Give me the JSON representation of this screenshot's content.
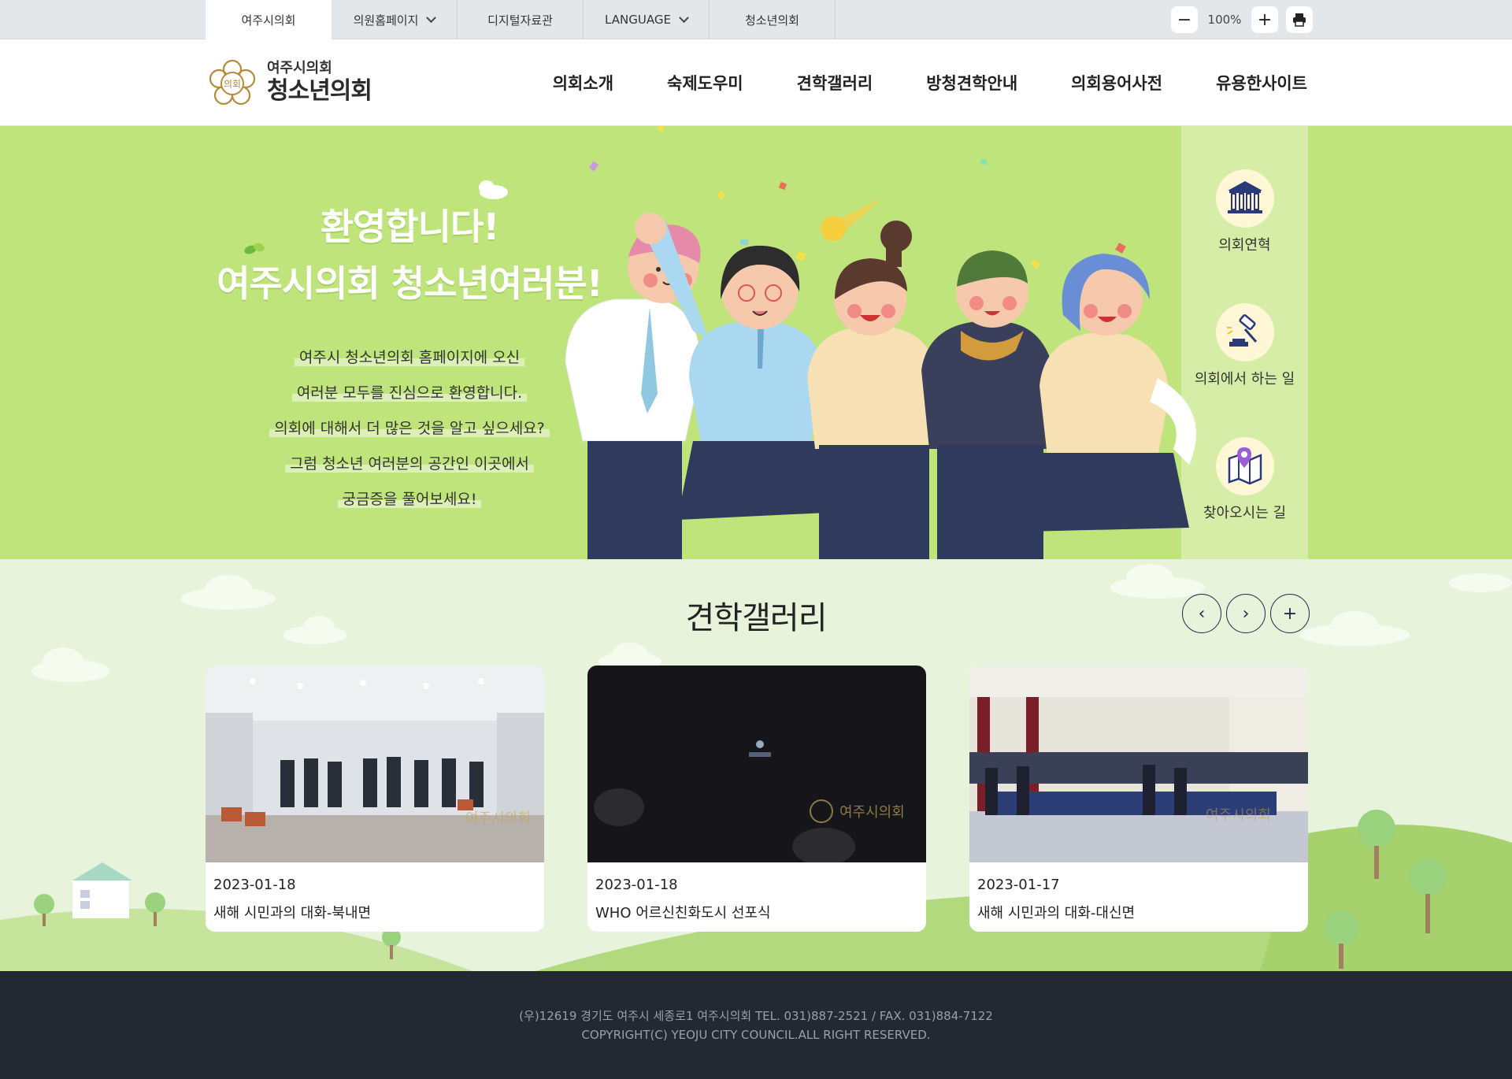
{
  "util": {
    "tabs": [
      {
        "label": "여주시의회"
      },
      {
        "label": "의원홈페이지"
      },
      {
        "label": "디지털자료관"
      },
      {
        "label": "LANGUAGE"
      },
      {
        "label": "청소년의회"
      }
    ],
    "zoom": {
      "minus": "−",
      "value": "100%",
      "plus": "+"
    }
  },
  "logo": {
    "small": "여주시의회",
    "big": "청소년의회",
    "emblem_text": "의회"
  },
  "gnb": [
    {
      "label": "의회소개"
    },
    {
      "label": "숙제도우미"
    },
    {
      "label": "견학갤러리"
    },
    {
      "label": "방청견학안내"
    },
    {
      "label": "의회용어사전"
    },
    {
      "label": "유용한사이트"
    }
  ],
  "hero": {
    "title_line1": "환영합니다!",
    "title_line2": "여주시의회 청소년여러분!",
    "desc": [
      "여주시 청소년의회 홈페이지에 오신",
      "여러분 모두를 진심으로 환영합니다.",
      "의회에 대해서 더 많은 것을 알고 싶으세요?",
      "그럼 청소년 여러분의 공간인 이곳에서",
      "궁금증을 풀어보세요!"
    ]
  },
  "side": [
    {
      "label": "의회연혁",
      "icon": "building-icon"
    },
    {
      "label": "의회에서 하는 일",
      "icon": "gavel-icon"
    },
    {
      "label": "찾아오시는 길",
      "icon": "map-pin-icon"
    }
  ],
  "gallery": {
    "title": "견학갤러리",
    "prev": "‹",
    "next": "›",
    "more": "+",
    "items": [
      {
        "date": "2023-01-18",
        "caption": "새해 시민과의 대화-북내면",
        "watermark": "여주시의회"
      },
      {
        "date": "2023-01-18",
        "caption": "WHO 어르신친화도시 선포식",
        "watermark": "여주시의회"
      },
      {
        "date": "2023-01-17",
        "caption": "새해 시민과의 대화-대신면",
        "watermark": "여주시의회"
      }
    ]
  },
  "footer": {
    "address": "(우)12619 경기도 여주시 세종로1 여주시의회 TEL. 031)887-2521 / FAX. 031)884-7122",
    "copyright": "COPYRIGHT(C) YEOJU CITY COUNCIL.ALL RIGHT RESERVED."
  },
  "colors": {
    "hero_bg": "#c0e47c",
    "side_bg": "#d6eda8",
    "gallery_bg": "#e8f3dc",
    "footer_bg": "#232832",
    "accent_navy": "#1e2a4a"
  }
}
